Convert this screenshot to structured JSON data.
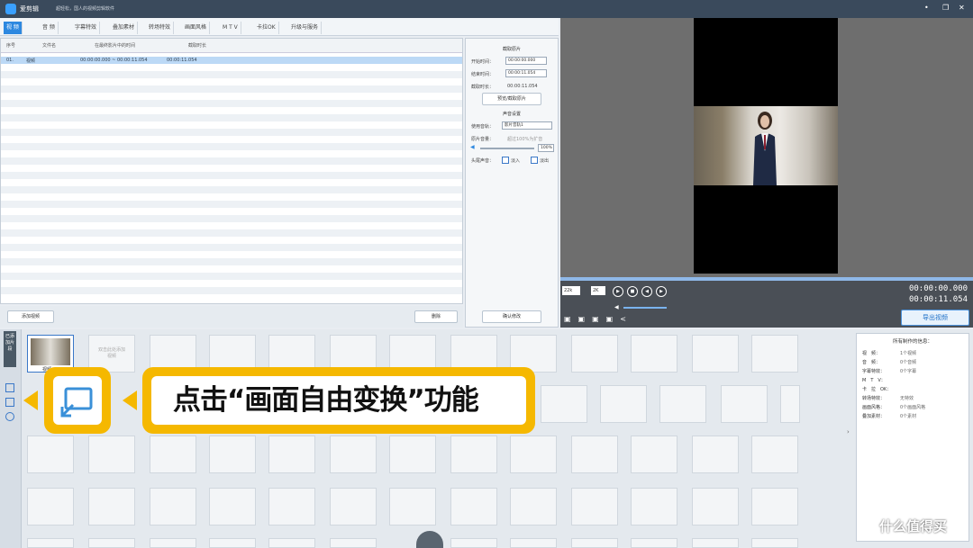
{
  "titlebar": {
    "app_name": "爱剪辑",
    "slogan": "超轻松，国人的视频剪辑软件",
    "minimize": "•",
    "restore": "❐",
    "close": "✕"
  },
  "menu_tabs": [
    "视 频",
    "音 频",
    "字幕特效",
    "叠加素材",
    "转场特效",
    "画面风格",
    "M T V",
    "卡拉OK",
    "升级与服务"
  ],
  "filelist": {
    "headers": [
      "序号",
      "文件名",
      "在最终影片中的时间",
      "截取时长"
    ],
    "row": {
      "index": "01.",
      "name": "视频",
      "time": "00:00:00.000 ~ 00:00:11.054",
      "duration": "00:00:11.054"
    }
  },
  "buttons": {
    "add_video": "添加视频",
    "delete": "删除",
    "confirm": "确认修改",
    "export": "导出视频"
  },
  "settings": {
    "clip_title": "截取原片",
    "start_label": "开始时间：",
    "start_value": "00:00:00.000",
    "end_label": "结束时间：",
    "end_value": "00:00:11.054",
    "duration_label": "截取时长：",
    "duration_value": "00:00:11.054",
    "preview_btn": "预览/截取原片",
    "audio_title": "声音设置",
    "track_label": "使用音轨：",
    "track_value": "影片音轨1",
    "volume_label": "原片音量：",
    "volume_hint": "超过100%为扩音",
    "volume_value": "100%",
    "fade_label": "头尾声音：",
    "fade_in": "淡入",
    "fade_out": "淡出"
  },
  "player": {
    "current_time": "00:00:00.000",
    "total_time": "00:00:11.054",
    "speed_a": "22k",
    "speed_b": "2K"
  },
  "timeline": {
    "side_tab": "已添加片段",
    "clip_label": "视频",
    "placeholder": "双击此处添加视频"
  },
  "info_panel": {
    "title": "所有制作的信息：",
    "items": [
      {
        "k": "视　频：",
        "v": "1个视频"
      },
      {
        "k": "音　频：",
        "v": "0个音频"
      },
      {
        "k": "字幕特效：",
        "v": "0个字幕"
      },
      {
        "k": "M　T　V：",
        "v": ""
      },
      {
        "k": "卡　拉　OK：",
        "v": ""
      },
      {
        "k": "转场特效：",
        "v": "无特效"
      },
      {
        "k": "画面风格：",
        "v": "0个画面风格"
      },
      {
        "k": "叠加素材：",
        "v": "0个素材"
      }
    ]
  },
  "callout": {
    "text": "点击“画面自由变换”功能"
  },
  "watermark": "什么值得买",
  "colors": {
    "accent": "#2d88e0",
    "callout": "#f5b800",
    "titlebar": "#3a4a5c"
  }
}
